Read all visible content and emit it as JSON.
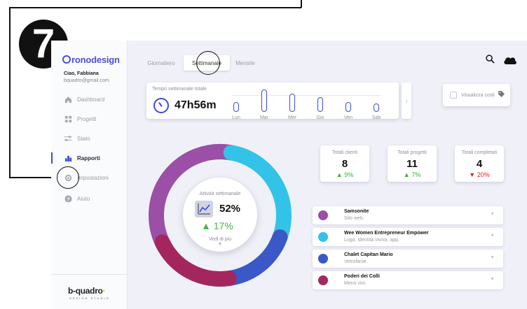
{
  "annotation": {
    "step_number": "7"
  },
  "sidebar": {
    "brand": "ronodesign",
    "greeting": "Ciao, Fabbiana",
    "email": "bquadro@gmail.com",
    "items": [
      {
        "label": "Dashboard",
        "icon": "home-icon"
      },
      {
        "label": "Progetti",
        "icon": "grid-icon"
      },
      {
        "label": "Stato",
        "icon": "sliders-icon"
      },
      {
        "label": "Rapporti",
        "icon": "bar-chart-icon"
      },
      {
        "label": "Impostazioni",
        "icon": "gear-icon"
      },
      {
        "label": "Aiuto",
        "icon": "help-icon"
      }
    ],
    "footer_logo": "b-quadro",
    "footer_sub": "DESIGN STUDIO"
  },
  "tabs": [
    "Giornaliero",
    "Settimanale",
    "Mensile"
  ],
  "weekly": {
    "title": "Tempo settimanale totale",
    "total": "47h56m",
    "days": [
      {
        "label": "Lun",
        "level": 0.45
      },
      {
        "label": "Mar",
        "level": 1.0
      },
      {
        "label": "Mer",
        "level": 0.8
      },
      {
        "label": "Gio",
        "level": 0.65
      },
      {
        "label": "Ven",
        "level": 0.45
      },
      {
        "label": "Sab",
        "level": 0.3
      }
    ]
  },
  "costs": {
    "label": "Visualizza costi"
  },
  "activity": {
    "title": "Attività settimanale",
    "percent": "52%",
    "delta": "17%",
    "see_more": "Vedi di più"
  },
  "totals": [
    {
      "title": "Totali clienti",
      "value": "8",
      "delta": "9%",
      "trend": "up"
    },
    {
      "title": "Totali progetti",
      "value": "11",
      "delta": "7%",
      "trend": "up"
    },
    {
      "title": "Totali completati",
      "value": "4",
      "delta": "20%",
      "trend": "down"
    }
  ],
  "clients": [
    {
      "name": "Samsonite",
      "desc": "Sito web.",
      "color": "#9b4fa6"
    },
    {
      "name": "Wee Women Entrepreneur Empower",
      "desc": "Logo, identità visiva, app.",
      "color": "#33c3e8"
    },
    {
      "name": "Chalet Capitan Mario",
      "desc": "Vetrofanie.",
      "color": "#3a58c8"
    },
    {
      "name": "Poderi dei Colli",
      "desc": "Menù vini.",
      "color": "#a3275e"
    }
  ],
  "colors": {
    "accent": "#3b4be0",
    "up": "#3aae3a",
    "down": "#e02020"
  }
}
